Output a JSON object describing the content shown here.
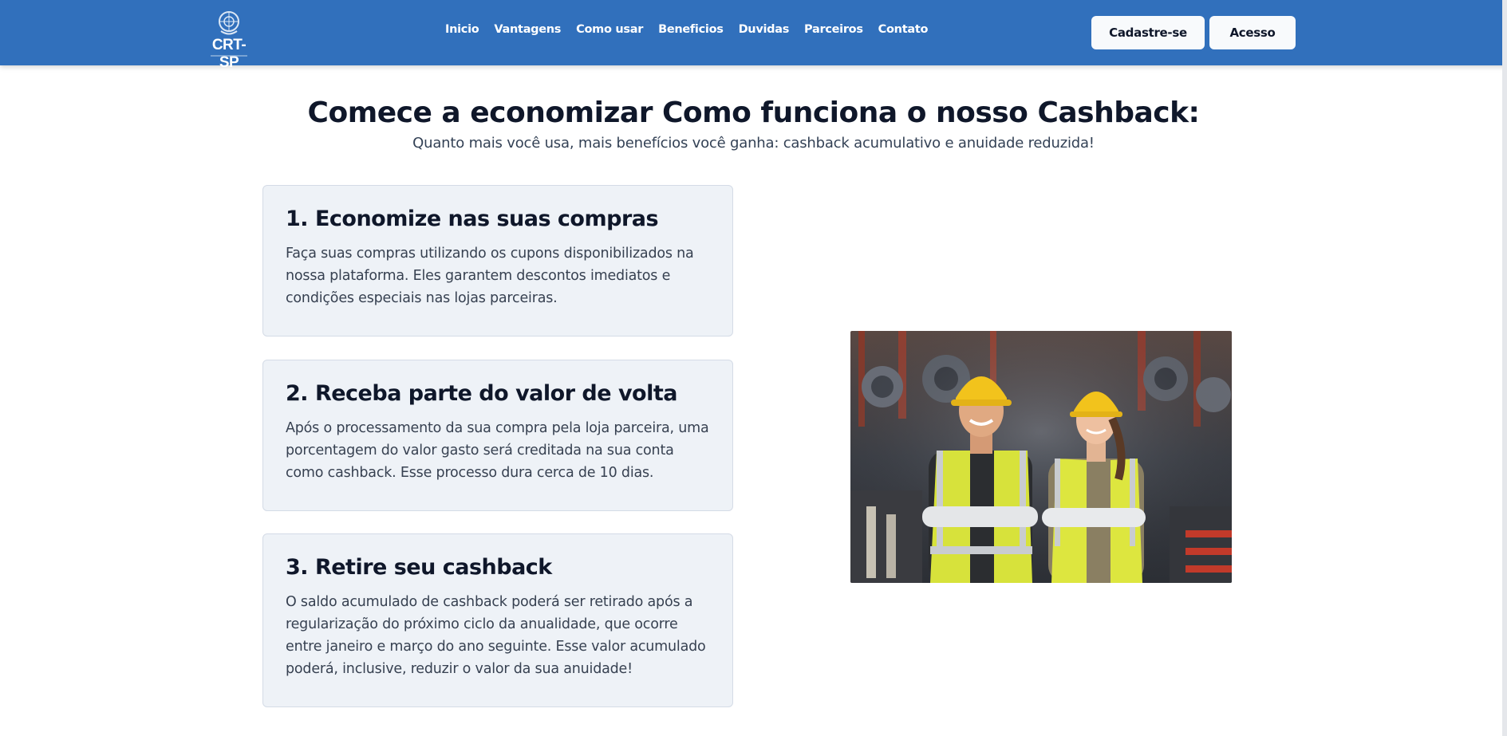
{
  "header": {
    "logo_text": "CRT-SP",
    "nav": [
      "Inicio",
      "Vantagens",
      "Como usar",
      "Beneficios",
      "Duvidas",
      "Parceiros",
      "Contato"
    ],
    "signup_label": "Cadastre-se",
    "login_label": "Acesso"
  },
  "main": {
    "title": "Comece a economizar Como funciona o nosso Cashback:",
    "subtitle": "Quanto mais você usa, mais benefícios você ganha: cashback acumulativo e anuidade reduzida!",
    "steps": [
      {
        "title": "1. Economize nas suas compras",
        "text": "Faça suas compras utilizando os cupons disponibilizados na nossa plataforma. Eles garantem descontos imediatos e condições especiais nas lojas parceiras."
      },
      {
        "title": "2. Receba parte do valor de volta",
        "text": "Após o processamento da sua compra pela loja parceira, uma porcentagem do valor gasto será creditada na sua conta como cashback. Esse processo dura cerca de 10 dias."
      },
      {
        "title": "3. Retire seu cashback",
        "text": "O saldo acumulado de cashback poderá ser retirado após a regularização do próximo ciclo da anualidade, que ocorre entre janeiro e março do ano seguinte. Esse valor acumulado poderá, inclusive, reduzir o valor da sua anuidade!"
      }
    ]
  },
  "colors": {
    "header_bg": "#3170bc",
    "card_bg": "#eef2f7",
    "title_color": "#0f172a"
  }
}
